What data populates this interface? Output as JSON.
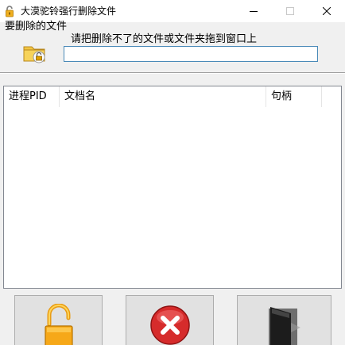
{
  "window": {
    "title": "大漠驼铃强行删除文件"
  },
  "form": {
    "section_label": "要删除的文件",
    "hint": "请把删除不了的文件或文件夹拖到窗口上",
    "path_value": ""
  },
  "list": {
    "columns": [
      {
        "label": "进程PID"
      },
      {
        "label": "文档名"
      },
      {
        "label": "句柄"
      }
    ],
    "rows": []
  },
  "buttons": {
    "unlock": {
      "icon": "unlock-icon"
    },
    "delete": {
      "icon": "delete-x-icon"
    },
    "exit": {
      "icon": "exit-door-icon"
    }
  },
  "colors": {
    "input_border": "#4a8ab8",
    "delete_red": "#d62b2b",
    "lock_gold": "#f0a020"
  }
}
